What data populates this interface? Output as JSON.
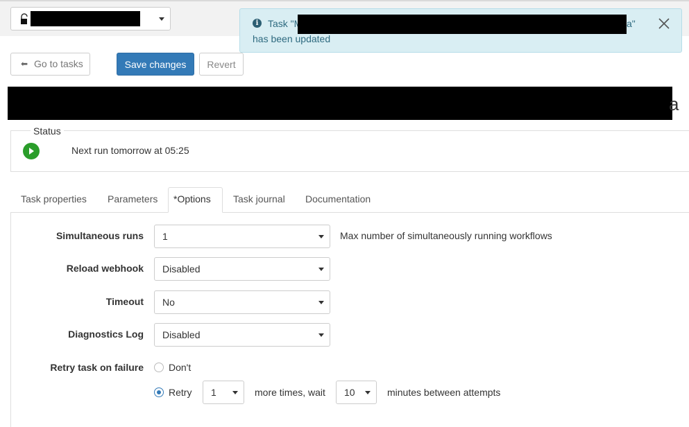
{
  "header": {
    "workspace_selector": {
      "icon": "lock-icon",
      "value": ""
    },
    "toast": {
      "prefix": "Task \"M",
      "suffix": "a\"",
      "line2": "has been updated",
      "icon": "info-icon"
    }
  },
  "toolbar": {
    "back_label": "Go to tasks",
    "save_label": "Save changes",
    "revert_label": "Revert"
  },
  "task_title_tail": "a",
  "status": {
    "legend": "Status",
    "text": "Next run tomorrow at 05:25",
    "icon": "play-icon",
    "color": "#2a9d2a"
  },
  "tabs": [
    {
      "label": "Task properties",
      "active": false
    },
    {
      "label": "Parameters",
      "active": false
    },
    {
      "label": "*Options",
      "active": true
    },
    {
      "label": "Task journal",
      "active": false
    },
    {
      "label": "Documentation",
      "active": false
    }
  ],
  "options": {
    "simultaneous_runs": {
      "label": "Simultaneous runs",
      "value": "1",
      "hint": "Max number of simultaneously running workflows"
    },
    "reload_webhook": {
      "label": "Reload webhook",
      "value": "Disabled"
    },
    "timeout": {
      "label": "Timeout",
      "value": "No"
    },
    "diagnostics_log": {
      "label": "Diagnostics Log",
      "value": "Disabled"
    },
    "retry": {
      "label": "Retry task on failure",
      "dont_label": "Don't",
      "retry_label": "Retry",
      "selected": "Retry",
      "times_value": "1",
      "more_times_text": "more times, wait",
      "wait_value": "10",
      "minutes_text": "minutes between attempts"
    }
  },
  "colors": {
    "primary": "#337ab7",
    "toast_bg": "#d9eef3",
    "status_green": "#2a9d2a"
  }
}
